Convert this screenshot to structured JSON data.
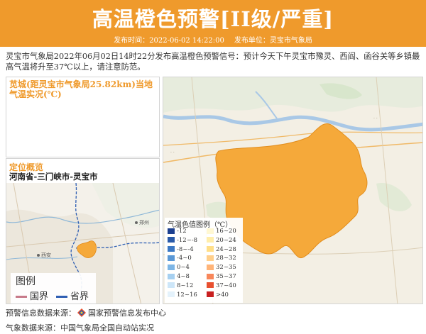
{
  "header": {
    "title": "高温橙色预警[II级/严重]",
    "publish_time_label": "发布时间：2022-06-02 14:22:00",
    "publisher_label": "发布单位：灵宝市气象局",
    "bg_color": "#ef9a2c"
  },
  "description": "灵宝市气象局2022年06月02日14时22分发布高温橙色预警信号：预计今天下午灵宝市豫灵、西阎、函谷关等乡镇最高气温将升至37℃以上，请注意防范。",
  "weather_panel": {
    "title": "苋城(距灵宝市气象局25.82km)当地气温实况(℃)"
  },
  "location_panel": {
    "title": "定位概览",
    "location": "河南省-三门峡市-灵宝市",
    "map_labels": [
      "郑州",
      "西安"
    ],
    "legend": {
      "title": "图例",
      "items": [
        {
          "label": "国界",
          "color": "#c77a8a"
        },
        {
          "label": "省界",
          "color": "#2f5fb3"
        }
      ]
    }
  },
  "main_map": {
    "warning_area_color": "#f5a93a",
    "legend": {
      "title": "气温色值图例（℃）",
      "items": [
        {
          "label": "-12",
          "color": "#1c3f8f"
        },
        {
          "label": "-12~-8",
          "color": "#2a5aa8"
        },
        {
          "label": "-8~-4",
          "color": "#3b78c4"
        },
        {
          "label": "-4~0",
          "color": "#5a98d6"
        },
        {
          "label": "0~4",
          "color": "#7db6e6"
        },
        {
          "label": "4~8",
          "color": "#a6d0f0"
        },
        {
          "label": "8~12",
          "color": "#cde6f8"
        },
        {
          "label": "12~16",
          "color": "#e4f2fb"
        },
        {
          "label": "16~20",
          "color": "#fff8d2"
        },
        {
          "label": "20~24",
          "color": "#ffeeaa"
        },
        {
          "label": "24~28",
          "color": "#ffdf88"
        },
        {
          "label": "28~32",
          "color": "#ffcf8a"
        },
        {
          "label": "32~35",
          "color": "#ffb478"
        },
        {
          "label": "35~37",
          "color": "#f8875a"
        },
        {
          "label": "37~40",
          "color": "#e8502f"
        },
        {
          "label": ">40",
          "color": "#c82020"
        }
      ]
    }
  },
  "sources": {
    "warning_source": "预警信息数据来源：",
    "warning_center": "国家预警信息发布中心",
    "weather_source": "气象数据来源：中国气象局全国自动站实况"
  }
}
